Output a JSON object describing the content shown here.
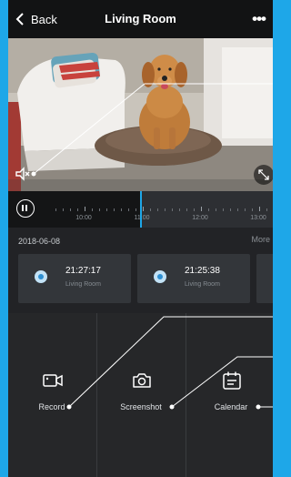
{
  "header": {
    "back_label": "Back",
    "title": "Living Room",
    "more_icon": "more-dots-icon"
  },
  "video": {
    "mute_icon": "speaker-muted-icon",
    "fullscreen_icon": "fullscreen-icon"
  },
  "timeline": {
    "labels": [
      "10:00",
      "11:00",
      "12:00",
      "13:00"
    ]
  },
  "recordings": {
    "date": "2018-06-08",
    "more_label": "More",
    "items": [
      {
        "time": "21:27:17",
        "room": "Living Room"
      },
      {
        "time": "21:25:38",
        "room": "Living Room"
      }
    ]
  },
  "actions": {
    "record_label": "Record",
    "screenshot_label": "Screenshot",
    "calendar_label": "Calendar"
  },
  "colors": {
    "accent": "#1ea7e8",
    "background": "#1c1d1f"
  }
}
